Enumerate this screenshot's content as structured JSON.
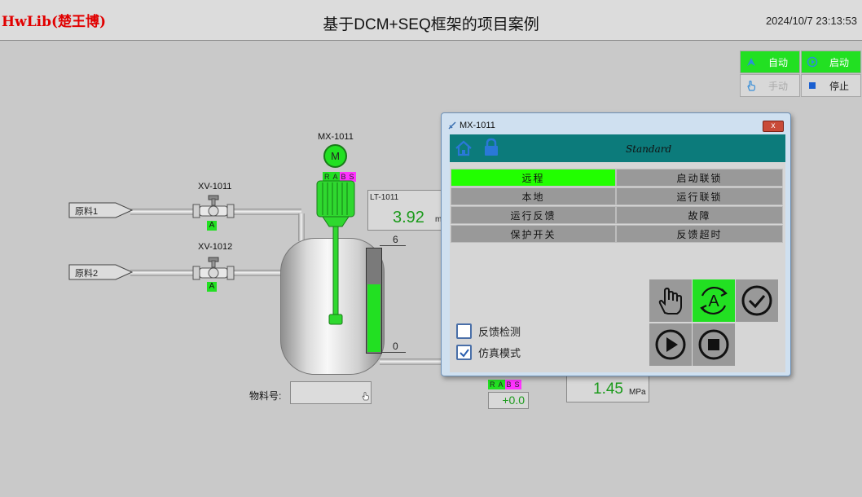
{
  "header": {
    "logo": "HwLib(楚王博)",
    "title": "基于DCM+SEQ框架的项目案例",
    "datetime": "2024/10/7 23:13:53"
  },
  "mode_buttons": {
    "auto": "自动",
    "manual": "手动",
    "start": "启动",
    "stop": "停止"
  },
  "sources": {
    "src1": "原料1",
    "src2": "原料2"
  },
  "valves": {
    "xv1011": {
      "name": "XV-1011",
      "state": "A"
    },
    "xv1012": {
      "name": "XV-1012",
      "state": "A"
    }
  },
  "mixer": {
    "name": "MX-1011",
    "motor": "M",
    "flags": [
      "R",
      "A",
      "B",
      "S"
    ]
  },
  "level": {
    "name": "LT-1011",
    "value": "3.92",
    "max": "6",
    "min": "0",
    "fill_fraction": 0.65
  },
  "pressure": {
    "value": "1.45",
    "unit": "MPa"
  },
  "pump": {
    "flags": [
      "R",
      "A",
      "B",
      "S"
    ],
    "value": "+0.0"
  },
  "material": {
    "label": "物料号:"
  },
  "dialog": {
    "title": "MX-1011",
    "close": "x",
    "mode": "Standard",
    "status_grid": [
      {
        "left": "远程",
        "right": "启动联锁",
        "left_active": true
      },
      {
        "left": "本地",
        "right": "运行联锁",
        "left_active": false
      },
      {
        "left": "运行反馈",
        "right": "故障",
        "left_active": false
      },
      {
        "left": "保护开关",
        "right": "反馈超时",
        "left_active": false
      }
    ],
    "checkboxes": [
      {
        "label": "反馈检测",
        "checked": false
      },
      {
        "label": "仿真模式",
        "checked": true
      }
    ],
    "buttons": [
      "hand-icon",
      "auto-icon",
      "confirm-icon",
      "play-icon",
      "stop-icon"
    ],
    "auto_symbol": "A"
  }
}
